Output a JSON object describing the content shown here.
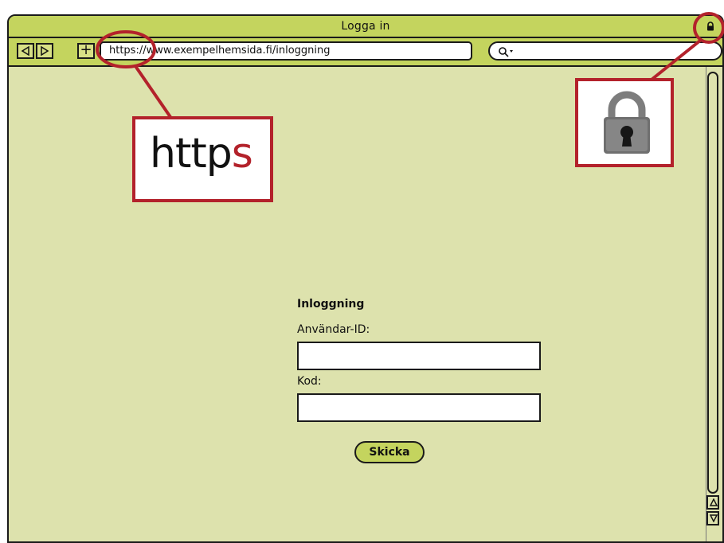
{
  "window": {
    "title": "Logga in"
  },
  "toolbar": {
    "back_icon": "back-arrow-icon",
    "forward_icon": "forward-arrow-icon",
    "new_tab_label": "+",
    "address": "https://www.exempelhemsida.fi/inloggning",
    "search_placeholder": "",
    "search_icon": "search-icon"
  },
  "callouts": {
    "https_prefix": "http",
    "https_suffix": "s",
    "lock_icon": "padlock-icon"
  },
  "login": {
    "title": "Inloggning",
    "username_label": "Användar-ID:",
    "username_value": "",
    "password_label": "Kod:",
    "password_value": "",
    "submit_label": "Skicka"
  },
  "colors": {
    "browser_chrome": "#c4d45e",
    "page_background": "#dde2ad",
    "callout_accent": "#b3222b",
    "text": "#111111"
  }
}
